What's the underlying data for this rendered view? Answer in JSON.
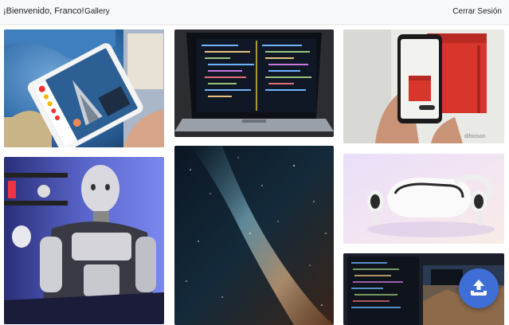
{
  "navbar": {
    "brand": "¡Bienvenido, Franco!",
    "gallery_link": "Gallery",
    "logout_link": "Cerrar Sesión"
  },
  "gallery": {
    "images": [
      {
        "subject": "tablet with augmented reality globe app"
      },
      {
        "subject": "laptop showing code editor"
      },
      {
        "subject": "hand holding phone with AR red chair",
        "watermark": "difooson"
      },
      {
        "subject": "humanoid robot in blue light"
      },
      {
        "subject": "milky way night sky"
      },
      {
        "subject": "white VR headset with controllers"
      },
      {
        "subject": "monitors with code and landscape wallpaper"
      }
    ]
  },
  "actions": {
    "upload_icon": "upload-icon"
  }
}
